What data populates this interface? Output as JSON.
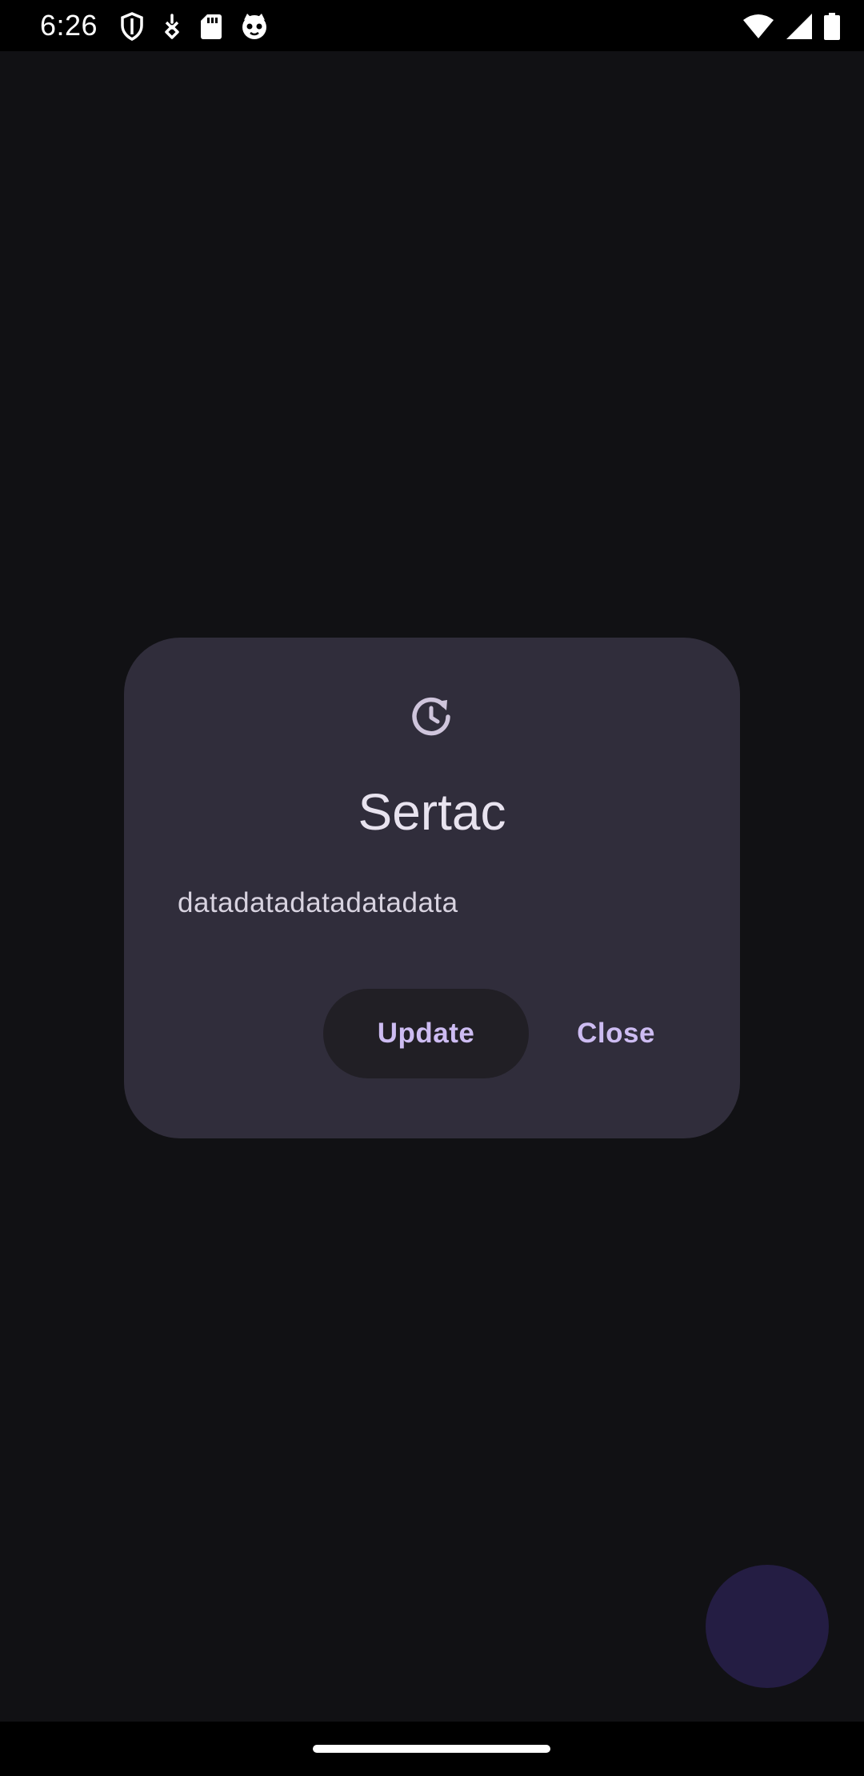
{
  "status_bar": {
    "time": "6:26",
    "left_icons": [
      "shield-icon",
      "vpn-key-icon",
      "sd-card-icon",
      "cat-face-icon"
    ],
    "right_icons": [
      "wifi-icon",
      "cellular-signal-icon",
      "battery-icon"
    ]
  },
  "dialog": {
    "icon": "update-history-icon",
    "title": "Sertac",
    "message": "datadatadatadatadata",
    "update_label": "Update",
    "close_label": "Close"
  },
  "colors": {
    "background": "#111114",
    "dialog_surface": "#302d3b",
    "accent_text": "#cdbcf2",
    "update_button_bg": "#211f25",
    "fab": "#241d43"
  }
}
